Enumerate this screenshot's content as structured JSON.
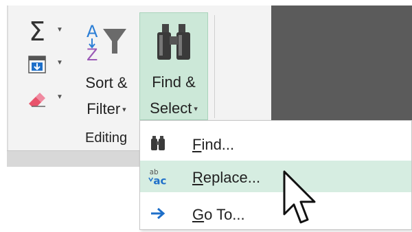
{
  "ribbon": {
    "group_label": "Editing",
    "autosum": {
      "icon": "sigma-icon",
      "symbol": "Σ"
    },
    "fill": {
      "icon": "fill-down-icon"
    },
    "clear": {
      "icon": "eraser-icon"
    },
    "sort_filter": {
      "icon": "sort-filter-icon",
      "line1": "Sort &",
      "line2": "Filter",
      "caret": "▾"
    },
    "find_select": {
      "icon": "binoculars-icon",
      "line1": "Find &",
      "line2": "Select",
      "caret": "▾"
    }
  },
  "menu": {
    "items": [
      {
        "icon": "binoculars-icon",
        "accel": "F",
        "rest": "ind...",
        "highlighted": false
      },
      {
        "icon": "replace-icon",
        "accel": "R",
        "rest": "eplace...",
        "highlighted": true
      },
      {
        "icon": "arrow-right-icon",
        "accel": "G",
        "rest": "o To...",
        "highlighted": false
      }
    ]
  },
  "colors": {
    "accent_highlight": "#cce8d8",
    "menu_hover": "#d6ede1",
    "arrow_blue": "#1e6fc9"
  }
}
